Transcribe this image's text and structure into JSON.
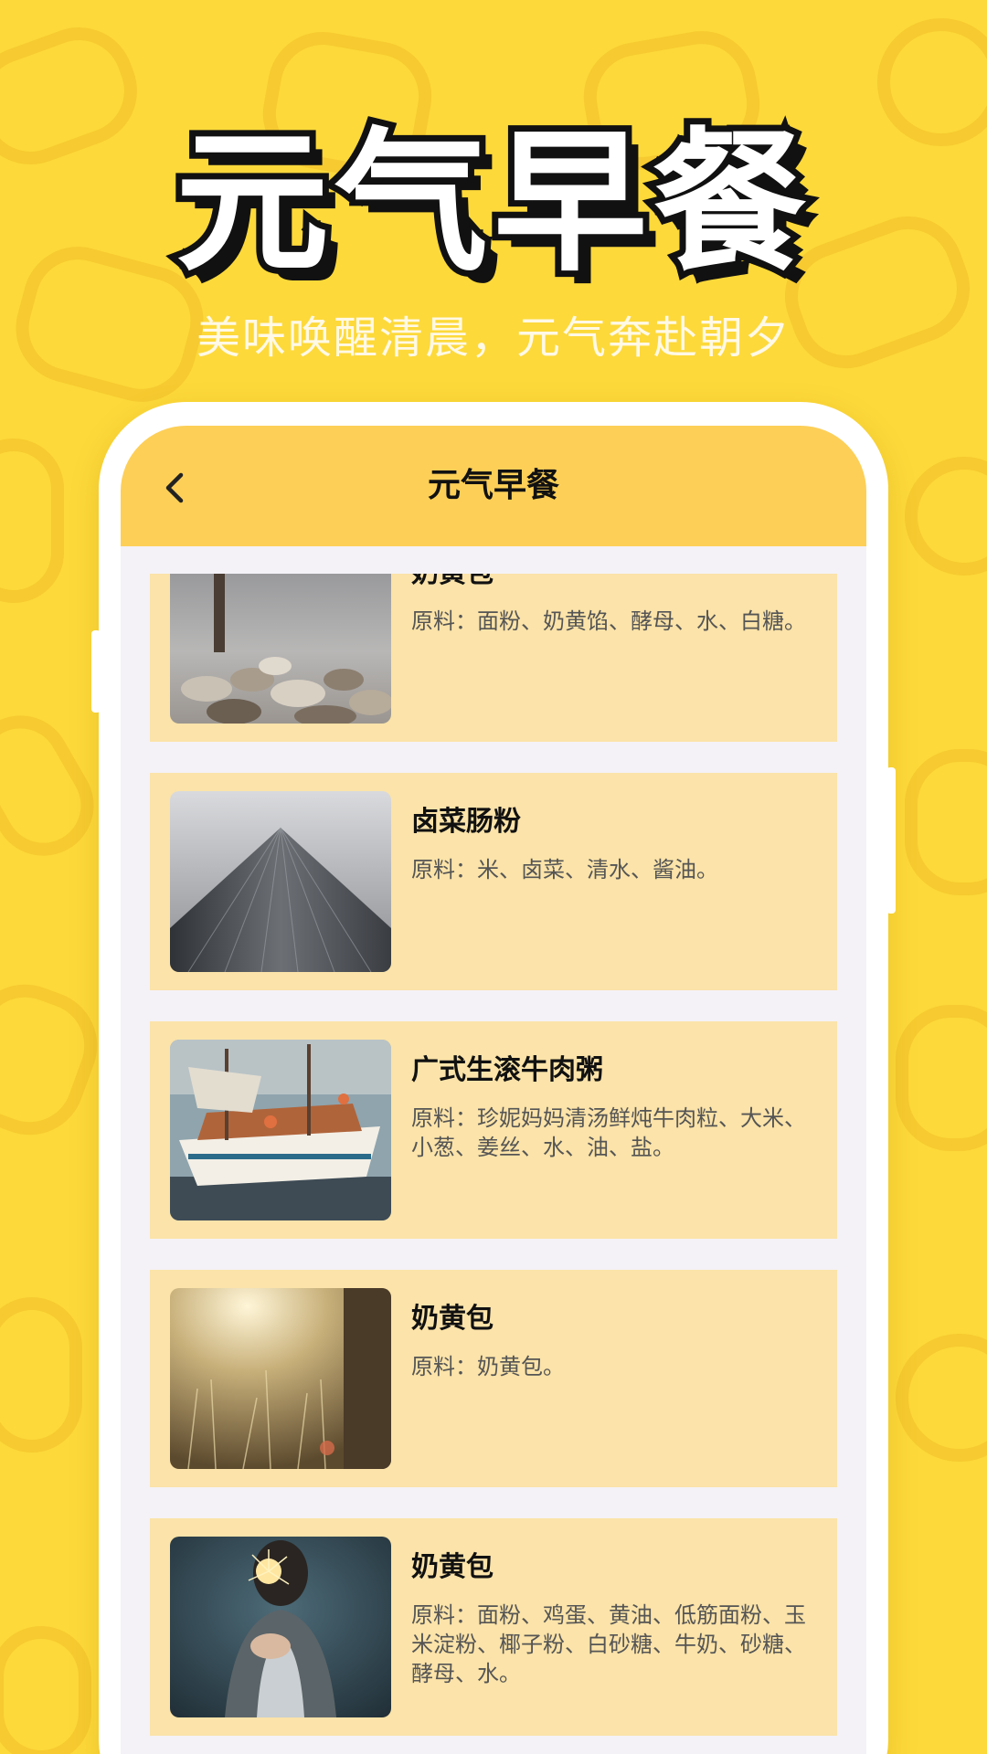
{
  "hero": {
    "title": "元气早餐",
    "subtitle": "美味唤醒清晨，元气奔赴朝夕"
  },
  "app": {
    "header_title": "元气早餐",
    "back_icon": "chevron-left-icon"
  },
  "items": [
    {
      "title": "奶黄包",
      "desc": "原料：面粉、奶黄馅、酵母、水、白糖。",
      "image": "rocks-and-post-photo"
    },
    {
      "title": "卤菜肠粉",
      "desc": "原料：米、卤菜、清水、酱油。",
      "image": "skyscraper-photo"
    },
    {
      "title": "广式生滚牛肉粥",
      "desc": "原料：珍妮妈妈清汤鲜炖牛肉粒、大米、小葱、姜丝、水、油、盐。",
      "image": "sailboat-photo"
    },
    {
      "title": "奶黄包",
      "desc": "原料：奶黄包。",
      "image": "sunlit-field-photo"
    },
    {
      "title": "奶黄包",
      "desc": "原料：面粉、鸡蛋、黄油、低筋面粉、玉米淀粉、椰子粉、白砂糖、牛奶、砂糖、酵母、水。",
      "image": "sparkler-photo"
    }
  ],
  "colors": {
    "background": "#fdd93a",
    "header": "#fdcf57",
    "card": "#fbe3a9"
  }
}
